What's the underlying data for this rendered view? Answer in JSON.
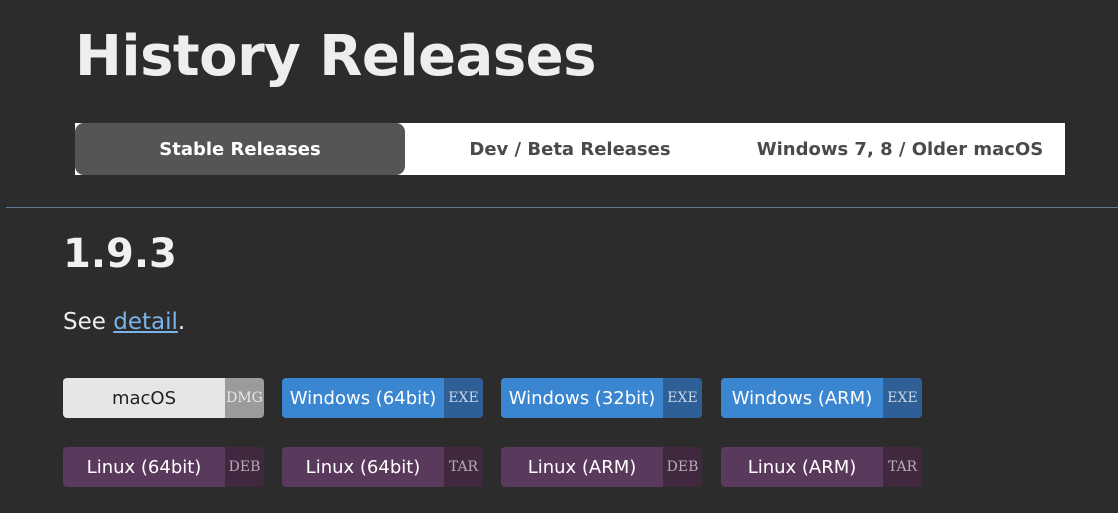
{
  "header": {
    "title": "History Releases"
  },
  "tabs": [
    {
      "label": "Stable Releases",
      "active": true
    },
    {
      "label": "Dev / Beta Releases",
      "active": false
    },
    {
      "label": "Windows 7, 8 / Older macOS",
      "active": false
    }
  ],
  "release": {
    "version": "1.9.3",
    "see_prefix": "See ",
    "detail_link": "detail",
    "see_suffix": "."
  },
  "downloads": [
    {
      "platform": "macOS",
      "ext": "DMG"
    },
    {
      "platform": "Windows (64bit)",
      "ext": "EXE"
    },
    {
      "platform": "Windows (32bit)",
      "ext": "EXE"
    },
    {
      "platform": "Windows (ARM)",
      "ext": "EXE"
    },
    {
      "platform": "Linux (64bit)",
      "ext": "DEB"
    },
    {
      "platform": "Linux (64bit)",
      "ext": "TAR"
    },
    {
      "platform": "Linux (ARM)",
      "ext": "DEB"
    },
    {
      "platform": "Linux (ARM)",
      "ext": "TAR"
    }
  ],
  "colors": {
    "background": "#2d2c2c",
    "windows_button": "#3b86d1",
    "linux_button": "#5a3a5c",
    "mac_button": "#e6e6e6",
    "link": "#7ab4e8"
  }
}
